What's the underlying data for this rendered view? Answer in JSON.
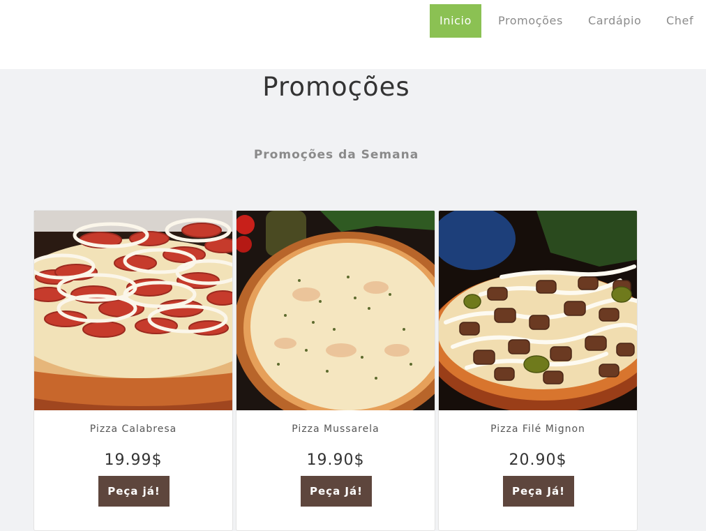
{
  "nav": {
    "items": [
      {
        "label": "Inicio",
        "active": true
      },
      {
        "label": "Promoções",
        "active": false
      },
      {
        "label": "Cardápio",
        "active": false
      },
      {
        "label": "Chef",
        "active": false
      }
    ],
    "accent_color": "#8bc153"
  },
  "header": {
    "title": "Promoções",
    "subtitle": "Promoções da Semana"
  },
  "products": [
    {
      "name": "Pizza Calabresa",
      "price": "19.99$",
      "button_label": "Peça já!",
      "image": "pizza-calabresa-image"
    },
    {
      "name": "Pizza Mussarela",
      "price": "19.90$",
      "button_label": "Peça Já!",
      "image": "pizza-mussarela-image"
    },
    {
      "name": "Pizza Filé Mignon",
      "price": "20.90$",
      "button_label": "Peça Já!",
      "image": "pizza-file-mignon-image"
    }
  ],
  "colors": {
    "button": "#5e463d",
    "page_background": "#f1f2f4"
  }
}
